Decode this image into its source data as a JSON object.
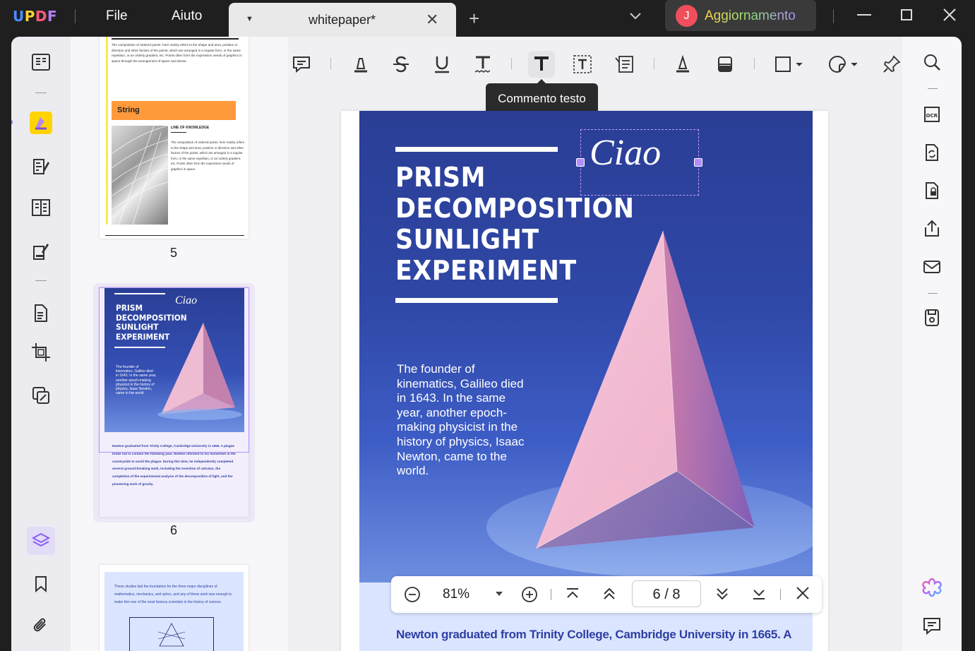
{
  "app": {
    "logo": "UPDF",
    "menu": [
      "File",
      "Aiuto"
    ],
    "tab_title": "whitepaper*",
    "avatar_initial": "J",
    "update_label": "Aggiornamento"
  },
  "toolbar": {
    "tooltip": "Commento testo"
  },
  "thumbnails": {
    "page5": {
      "number": "5",
      "intro_text": "The composition of ordered points: here mainly refers to the shape and area, position or direction and other factors of the points, which are arranged in a regular form, or the same repetition, or an orderly gradient, etc. Points often form the expression needs of graphics in space through the arrangement of space and dense.",
      "tag": "String",
      "heading": "LINE OF KNOWLEDGE",
      "body": "The composition of ordered points: here mainly refers to the shape and area, position or direction and other factors of the points, which are arranged in a regular form, or the same repetition, or an orderly gradient, etc. Points often form the expression needs of graphics in space."
    },
    "page6": {
      "number": "6",
      "ciao": "Ciao",
      "title": [
        "PRISM",
        "DECOMPOSITION",
        "SUNLIGHT",
        "EXPERIMENT"
      ],
      "body": "The founder of kinematics, Galileo died in 1643. In the same year, another epoch-making physicist in the history of physics, Isaac Newton, came to the world.",
      "lower": "Newton graduated from Trinity College, Cambridge University in 1665. A plague broke out in London the following year. Newton returned to his hometown in the countryside to avoid the plague. During this time, he independently completed several ground-breaking work, including the invention of calculus, the completion of the experimental analysis of the decomposition of light, and the pioneering work of gravity."
    },
    "page7": {
      "text": "These studies laid the foundation for the three major disciplines of mathematics, mechanics, and optics, and any of these work was enough to make him one of the most famous scientists in the history of science."
    }
  },
  "document": {
    "title_lines": [
      "PRISM",
      "DECOMPOSITION",
      "SUNLIGHT",
      "EXPERIMENT"
    ],
    "annotation": "Ciao",
    "body": "The founder of kinematics, Galileo died in 1643. In the same year, another epoch-making physicist in the history of physics, Isaac Newton, came to the world.",
    "lower_text": "Newton graduated from Trinity College, Cambridge University in 1665. A"
  },
  "zoom": {
    "percent": "81%",
    "page_indicator": "6  /  8"
  },
  "colors": {
    "accent": "#b58cff",
    "cover_blue": "#2f47a6",
    "lower_text": "#2d3fa3"
  }
}
